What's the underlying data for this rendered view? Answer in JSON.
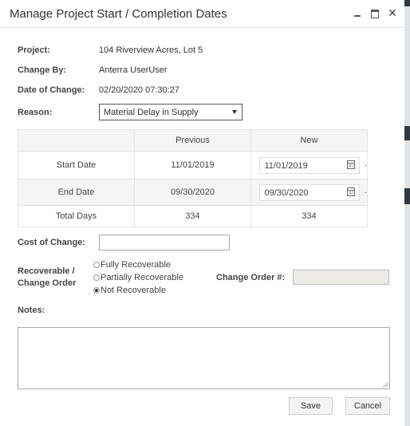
{
  "window": {
    "title": "Manage Project Start / Completion Dates",
    "minimize_icon": "minimize-icon",
    "maximize_icon": "maximize-icon",
    "close_glyph": "✕"
  },
  "info": {
    "project_label": "Project:",
    "project_value": "104 Riverview Acres, Lot 5",
    "change_by_label": "Change By:",
    "change_by_value": "Anterra UserUser",
    "date_label": "Date of Change:",
    "date_value": "02/20/2020 07:30:27",
    "reason_label": "Reason:",
    "reason_value": "Material Delay in Supply"
  },
  "dates_table": {
    "columns": [
      "",
      "Previous",
      "New"
    ],
    "rows": [
      {
        "label": "Start Date",
        "previous": "11/01/2019",
        "new": "11/01/2019",
        "editable": true
      },
      {
        "label": "End Date",
        "previous": "09/30/2020",
        "new": "09/30/2020",
        "editable": true
      },
      {
        "label": "Total Days",
        "previous": "334",
        "new": "334",
        "editable": false
      }
    ],
    "overflow_marks": [
      "-",
      "-"
    ]
  },
  "cost": {
    "label": "Cost of Change:",
    "value": ""
  },
  "recoverable": {
    "label_line1": "Recoverable /",
    "label_line2": "Change Order",
    "options": [
      {
        "label": "Fully Recoverable",
        "selected": false
      },
      {
        "label": "Partially Recoverable",
        "selected": false
      },
      {
        "label": "Not Recoverable",
        "selected": true
      }
    ],
    "change_order_label": "Change Order #:",
    "change_order_value": ""
  },
  "notes": {
    "label": "Notes:",
    "value": ""
  },
  "buttons": {
    "save": "Save",
    "cancel": "Cancel"
  },
  "colors": {
    "background_strip": "#2f3a45",
    "header_row": "#f5f5f5",
    "disabled_field": "#ebebe4"
  }
}
